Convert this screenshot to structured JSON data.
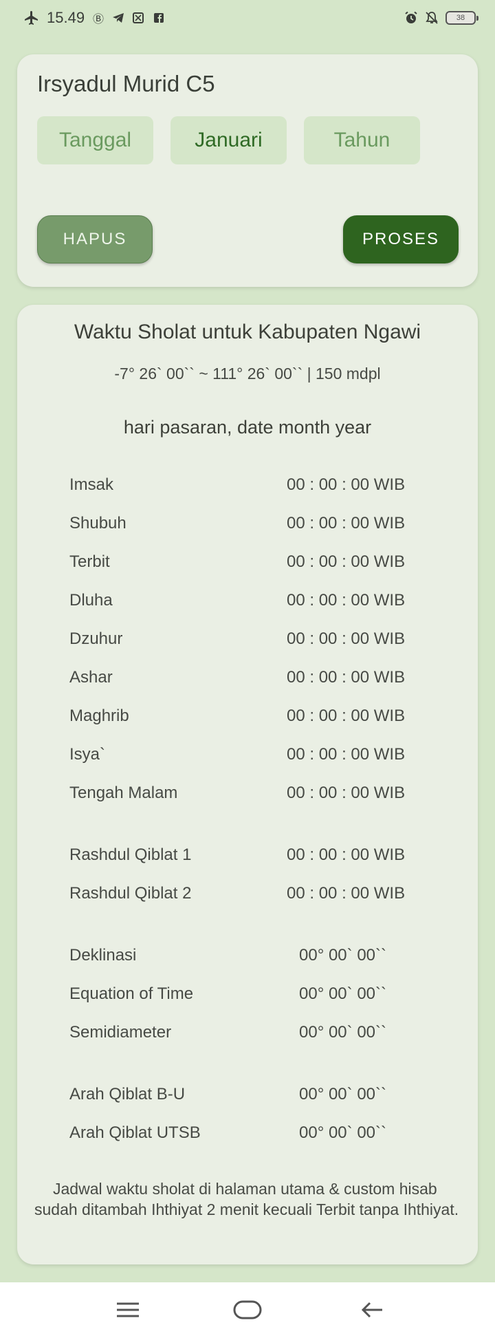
{
  "status_bar": {
    "time": "15.49",
    "battery_level": "38",
    "left_icons": [
      "airplane-icon",
      "b-icon",
      "telegram-icon",
      "screenshot-icon",
      "facebook-icon"
    ],
    "right_icons": [
      "alarm-icon",
      "mute-icon",
      "battery-icon"
    ]
  },
  "input_card": {
    "title": "Irsyadul Murid C5",
    "day_placeholder": "Tanggal",
    "month_value": "Januari",
    "year_placeholder": "Tahun",
    "reset_label": "HAPUS",
    "process_label": "PROSES"
  },
  "result_card": {
    "title": "Waktu Sholat untuk Kabupaten Ngawi",
    "coordinates": "-7° 26` 00`` ~ 111° 26` 00`` | 150 mdpl",
    "date_line": "hari pasaran, date month year",
    "prayer_times": [
      {
        "label": "Imsak",
        "value": "00 : 00 : 00 WIB"
      },
      {
        "label": "Shubuh",
        "value": "00 : 00 : 00 WIB"
      },
      {
        "label": "Terbit",
        "value": "00 : 00 : 00 WIB"
      },
      {
        "label": "Dluha",
        "value": "00 : 00 : 00 WIB"
      },
      {
        "label": "Dzuhur",
        "value": "00 : 00 : 00 WIB"
      },
      {
        "label": "Ashar",
        "value": "00 : 00 : 00 WIB"
      },
      {
        "label": "Maghrib",
        "value": "00 : 00 : 00 WIB"
      },
      {
        "label": "Isya`",
        "value": "00 : 00 : 00 WIB"
      },
      {
        "label": "Tengah Malam",
        "value": "00 : 00 : 00 WIB"
      }
    ],
    "qiblat_times": [
      {
        "label": "Rashdul Qiblat 1",
        "value": "00 : 00 : 00 WIB"
      },
      {
        "label": "Rashdul Qiblat 2",
        "value": "00 : 00 : 00 WIB"
      }
    ],
    "astro_values": [
      {
        "label": "Deklinasi",
        "value": "00° 00` 00``"
      },
      {
        "label": "Equation of Time",
        "value": "00° 00` 00``"
      },
      {
        "label": "Semidiameter",
        "value": "00° 00` 00``"
      }
    ],
    "qiblat_direction": [
      {
        "label": "Arah Qiblat B-U",
        "value": "00° 00` 00``"
      },
      {
        "label": "Arah Qiblat UTSB",
        "value": "00° 00` 00``"
      }
    ],
    "note": "Jadwal waktu sholat di halaman utama & custom hisab sudah ditambah Ihthiyat 2 menit kecuali Terbit tanpa Ihthiyat."
  },
  "nav_bar": {
    "icons": [
      "menu-icon",
      "home-icon",
      "back-icon"
    ]
  },
  "colors": {
    "background": "#d5e6c9",
    "card": "#eaefe4",
    "field": "#d5e6c9",
    "primary_button": "#2e641f",
    "secondary_button": "#779b6b"
  }
}
